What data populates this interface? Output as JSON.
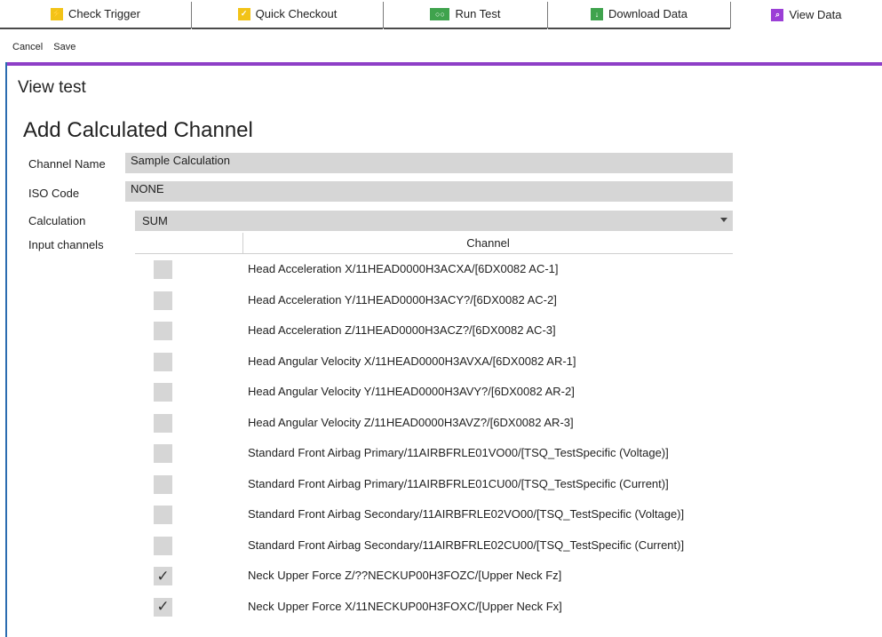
{
  "tabs": [
    {
      "label": "Check Trigger",
      "icon": "check-trigger-icon",
      "icon_color": "#f2c318",
      "active": false
    },
    {
      "label": "Quick Checkout",
      "icon": "quick-checkout-icon",
      "icon_color": "#f2c318",
      "active": false
    },
    {
      "label": "Run Test",
      "icon": "run-test-icon",
      "icon_color": "#3fa34d",
      "active": false
    },
    {
      "label": "Download Data",
      "icon": "download-data-icon",
      "icon_color": "#3fa34d",
      "active": false
    },
    {
      "label": "View Data",
      "icon": "view-data-icon",
      "icon_color": "#9b3fd6",
      "active": true
    }
  ],
  "toolbar": {
    "cancel_label": "Cancel",
    "save_label": "Save"
  },
  "page_title": "View test",
  "form": {
    "title": "Add Calculated Channel",
    "channel_name_label": "Channel Name",
    "channel_name_value": "Sample Calculation",
    "iso_code_label": "ISO Code",
    "iso_code_value": "NONE",
    "calculation_label": "Calculation",
    "calculation_value": "SUM",
    "input_channels_label": "Input channels"
  },
  "grid": {
    "column_header": "Channel",
    "rows": [
      {
        "label": "Head Acceleration X/11HEAD0000H3ACXA/[6DX0082 AC-1]",
        "checked": false,
        "mark": ""
      },
      {
        "label": "Head Acceleration Y/11HEAD0000H3ACY?/[6DX0082 AC-2]",
        "checked": false,
        "mark": ""
      },
      {
        "label": "Head Acceleration Z/11HEAD0000H3ACZ?/[6DX0082 AC-3]",
        "checked": false,
        "mark": ""
      },
      {
        "label": "Head Angular Velocity X/11HEAD0000H3AVXA/[6DX0082 AR-1]",
        "checked": false,
        "mark": ""
      },
      {
        "label": "Head Angular Velocity Y/11HEAD0000H3AVY?/[6DX0082 AR-2]",
        "checked": false,
        "mark": ""
      },
      {
        "label": "Head Angular Velocity Z/11HEAD0000H3AVZ?/[6DX0082 AR-3]",
        "checked": false,
        "mark": ""
      },
      {
        "label": "Standard Front Airbag Primary/11AIRBFRLE01VO00/[TSQ_TestSpecific (Voltage)]",
        "checked": false,
        "mark": ""
      },
      {
        "label": "Standard Front Airbag Primary/11AIRBFRLE01CU00/[TSQ_TestSpecific (Current)]",
        "checked": false,
        "mark": ""
      },
      {
        "label": "Standard Front Airbag Secondary/11AIRBFRLE02VO00/[TSQ_TestSpecific (Voltage)]",
        "checked": false,
        "mark": ""
      },
      {
        "label": "Standard Front Airbag Secondary/11AIRBFRLE02CU00/[TSQ_TestSpecific (Current)]",
        "checked": false,
        "mark": ""
      },
      {
        "label": "Neck Upper Force Z/??NECKUP00H3FOZC/[Upper Neck Fz]",
        "checked": true,
        "mark": "✓"
      },
      {
        "label": "Neck Upper Force X/11NECKUP00H3FOXC/[Upper Neck Fx]",
        "checked": true,
        "mark": "✓"
      }
    ]
  },
  "colors": {
    "accent": "#8e3fc7",
    "field_bg": "#d6d6d6",
    "left_edge": "#2b6cb0"
  }
}
